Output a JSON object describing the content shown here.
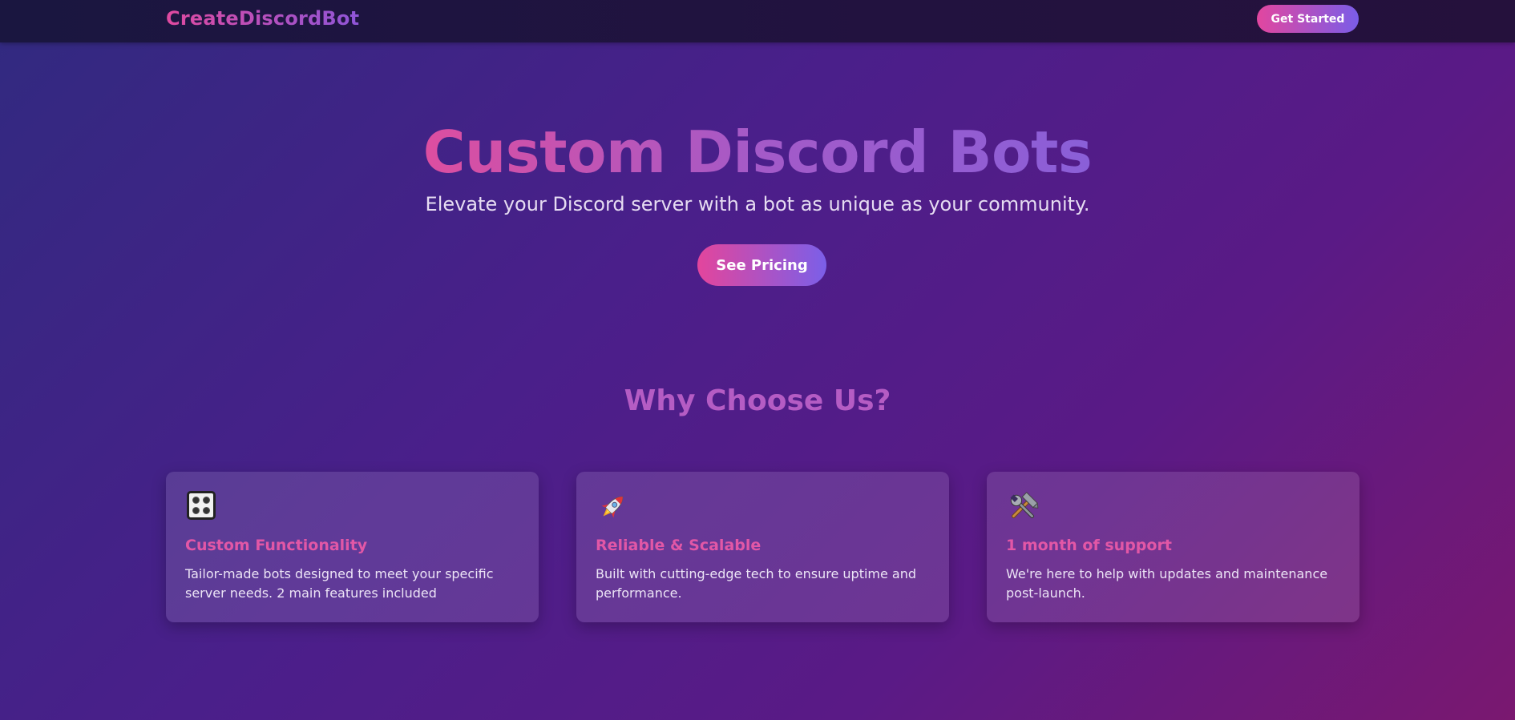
{
  "nav": {
    "brand": "CreateDiscordBot",
    "cta_label": "Get Started"
  },
  "hero": {
    "title": "Custom Discord Bots",
    "subtitle": "Elevate your Discord server with a bot as unique as your community.",
    "cta_label": "See Pricing"
  },
  "features": {
    "title": "Why Choose Us?",
    "cards": [
      {
        "icon": "dice-icon",
        "title": "Custom Functionality",
        "description": "Tailor-made bots designed to meet your specific server needs. 2 main features included"
      },
      {
        "icon": "rocket-icon",
        "title": "Reliable & Scalable",
        "description": "Built with cutting-edge tech to ensure uptime and performance."
      },
      {
        "icon": "tools-icon",
        "title": "1 month of support",
        "description": "We're here to help with updates and maintenance post-launch."
      }
    ]
  },
  "colors": {
    "accent_pink": "#e2469f",
    "accent_purple": "#7a5de8",
    "section_title": "#b55cc4",
    "card_title": "#e257a6"
  }
}
